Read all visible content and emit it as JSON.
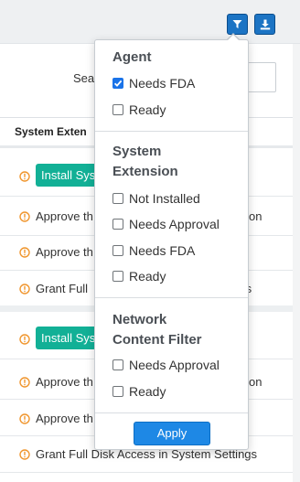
{
  "toolbar": {
    "filter_icon": "filter-icon",
    "download_icon": "download-icon",
    "accent_color": "#1c74c4"
  },
  "search": {
    "label": "Sea"
  },
  "table": {
    "column_header": "System Exten",
    "groups": [
      {
        "install_label": "Install Sys",
        "rows": [
          {
            "text": "Approve th",
            "tail": "on"
          },
          {
            "text": "Approve th",
            "tail": ""
          },
          {
            "text": "Grant Full",
            "tail": "ttings"
          }
        ]
      },
      {
        "install_label": "Install Sys",
        "rows": [
          {
            "text": "Approve th",
            "tail": "on"
          },
          {
            "text": "Approve th",
            "tail": ""
          },
          {
            "text": "Grant Full Disk Access in System Settings",
            "tail": ""
          }
        ]
      }
    ],
    "status_color": "#f0962e",
    "install_color": "#12b096"
  },
  "filter": {
    "sections": [
      {
        "title_lines": [
          "Agent"
        ],
        "options": [
          {
            "label": "Needs FDA",
            "checked": true
          },
          {
            "label": "Ready",
            "checked": false
          }
        ]
      },
      {
        "title_lines": [
          "System",
          "Extension"
        ],
        "options": [
          {
            "label": "Not Installed",
            "checked": false
          },
          {
            "label": "Needs Approval",
            "checked": false
          },
          {
            "label": "Needs FDA",
            "checked": false
          },
          {
            "label": "Ready",
            "checked": false
          }
        ]
      },
      {
        "title_lines": [
          "Network",
          "Content Filter"
        ],
        "options": [
          {
            "label": "Needs Approval",
            "checked": false
          },
          {
            "label": "Ready",
            "checked": false
          }
        ]
      }
    ],
    "apply_label": "Apply"
  }
}
